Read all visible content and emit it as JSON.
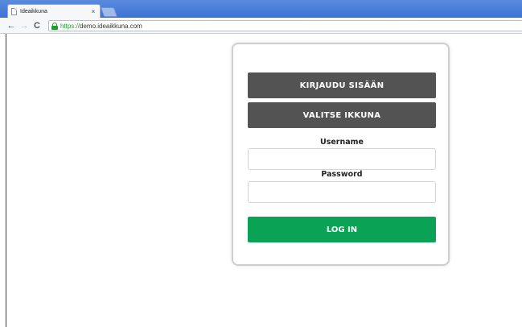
{
  "browser": {
    "tab_title": "Ideaikkuna",
    "tab_close": "×",
    "url_scheme": "https://",
    "url_rest": "demo.ideaikkuna.com",
    "back_glyph": "←",
    "forward_glyph": "→",
    "reload_glyph": "C"
  },
  "login": {
    "sign_in_label": "KIRJAUDU SISÄÄN",
    "select_window_label": "VALITSE IKKUNA",
    "username_label": "Username",
    "username_value": "",
    "password_label": "Password",
    "password_value": "",
    "submit_label": "LOG IN"
  },
  "colors": {
    "dark_button": "#535353",
    "login_button": "#0aa356",
    "secure_green": "#1e9e2b",
    "tabstrip_blue": "#3d73d4"
  },
  "icons": {
    "tab_favicon": "page-icon",
    "secure": "lock-icon",
    "back": "arrow-left-icon",
    "forward": "arrow-right-icon",
    "reload": "reload-icon",
    "close": "close-icon"
  }
}
